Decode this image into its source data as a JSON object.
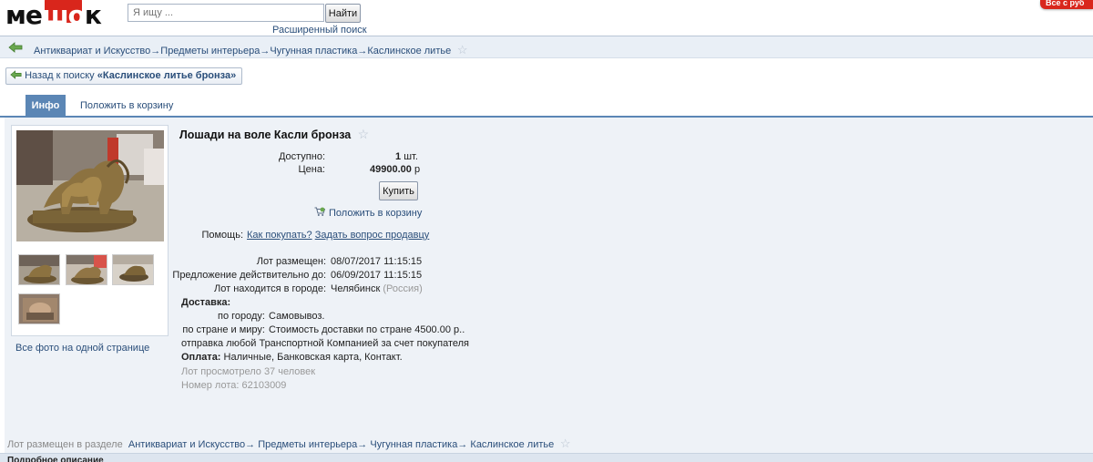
{
  "header": {
    "logo_text_1": "ме",
    "logo_text_2": "шо",
    "logo_text_3": "к",
    "search_placeholder": "Я ищу ...",
    "search_button": "Найти",
    "advanced_search": "Расширенный поиск",
    "corner_tab": "Все с руб"
  },
  "breadcrumbs": {
    "items": [
      "Антиквариат и Искусство",
      "Предметы интерьера",
      "Чугунная пластика",
      "Каслинское литье"
    ],
    "separator": "→"
  },
  "back_to_search": {
    "prefix": "Назад к поиску",
    "query": "«Каслинское литье бронза»"
  },
  "tabs": {
    "info": "Инфо",
    "add_to_cart": "Положить в корзину"
  },
  "lot": {
    "title": "Лошади на воле Касли бронза",
    "available_label": "Доступно:",
    "available_value": "1",
    "available_unit": "шт.",
    "price_label": "Цена:",
    "price_value": "49900.00",
    "price_unit": "р",
    "buy_button": "Купить",
    "add_to_cart": "Положить в корзину",
    "help_label": "Помощь:",
    "help_how_to_buy": "Как покупать?",
    "help_ask_seller": "Задать вопрос продавцу",
    "posted_label": "Лот размещен:",
    "posted_value": "08/07/2017 11:15:15",
    "valid_label": "Предложение действительно до:",
    "valid_value": "06/09/2017 11:15:15",
    "city_label": "Лот находится в городе:",
    "city_value": "Челябинск",
    "city_country": "(Россия)",
    "delivery_heading": "Доставка:",
    "delivery_city_label": "по городу:",
    "delivery_city_value": "Самовывоз.",
    "delivery_country_label": "по стране и миру:",
    "delivery_country_value": "Стоимость доставки по стране 4500.00 р..",
    "delivery_note": "отправка любой Транспортной Компанией за счет покупателя",
    "payment_label": "Оплата:",
    "payment_value": "Наличные, Банковская карта, Контакт.",
    "views_text": "Лот просмотрело 37 человек",
    "lot_number_text": "Номер лота: 62103009"
  },
  "photos": {
    "all_photos_link": "Все фото на одной странице"
  },
  "bottom": {
    "placed_in_label": "Лот размещен в разделе",
    "footer_heading": "Подробное описание"
  },
  "colors": {
    "accent": "#5b86b5",
    "link": "#2a4e7a",
    "logo_red": "#d9261c",
    "panel_bg": "#eef2f7"
  }
}
